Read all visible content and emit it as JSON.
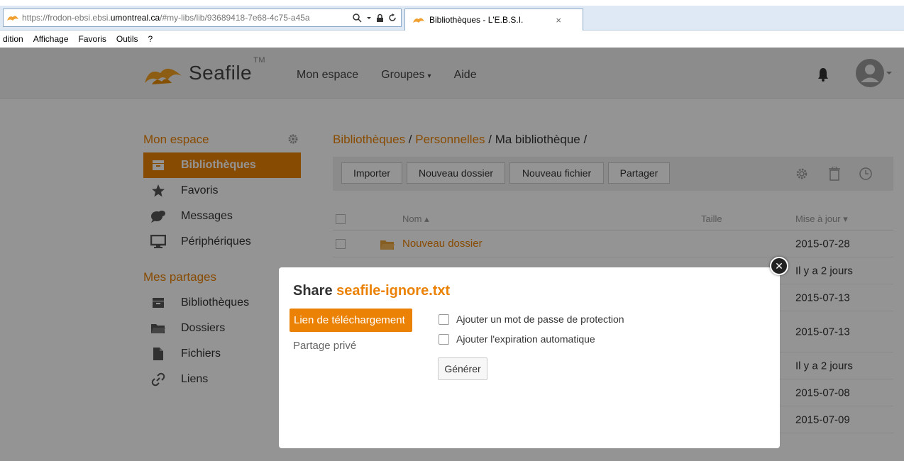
{
  "browser": {
    "url_prefix": "https://",
    "url_host_a": "frodon-ebsi.ebsi.",
    "url_host_b": "umontreal.ca",
    "url_path": "/#my-libs/lib/93689418-7e68-4c75-a45a",
    "tab_title": "Bibliothèques - L'E.B.S.I.",
    "tab_close": "×",
    "menu": [
      "dition",
      "Affichage",
      "Favoris",
      "Outils",
      "?"
    ]
  },
  "header": {
    "logo_sea": "Sea",
    "logo_file": "file",
    "logo_tm": "TM",
    "nav": [
      {
        "label": "Mon espace"
      },
      {
        "label": "Groupes",
        "caret": "▾"
      },
      {
        "label": "Aide"
      }
    ]
  },
  "sidebar": {
    "my_space_title": "Mon espace",
    "items": [
      {
        "label": "Bibliothèques",
        "icon": "library-icon",
        "active": true
      },
      {
        "label": "Favoris",
        "icon": "star-icon"
      },
      {
        "label": "Messages",
        "icon": "message-icon"
      },
      {
        "label": "Périphériques",
        "icon": "monitor-icon"
      }
    ],
    "shares_title": "Mes partages",
    "share_items": [
      {
        "label": "Bibliothèques",
        "icon": "library-icon"
      },
      {
        "label": "Dossiers",
        "icon": "folder-icon"
      },
      {
        "label": "Fichiers",
        "icon": "file-icon"
      },
      {
        "label": "Liens",
        "icon": "link-icon"
      }
    ]
  },
  "main": {
    "breadcrumb": {
      "part1": "Bibliothèques",
      "sep1": " / ",
      "part2": "Personnelles",
      "sep2": " / ",
      "current": "Ma bibliothèque /"
    },
    "toolbar": {
      "import": "Importer",
      "new_folder": "Nouveau dossier",
      "new_file": "Nouveau fichier",
      "share": "Partager"
    },
    "table": {
      "col_name": "Nom",
      "col_name_sort": "▴",
      "col_size": "Taille",
      "col_updated": "Mise à jour",
      "col_updated_sort": "▾",
      "rows": [
        {
          "name": "Nouveau dossier",
          "date": "2015-07-28"
        },
        {
          "name": "",
          "date": "Il y a 2 jours"
        },
        {
          "name": "",
          "date": "2015-07-13"
        },
        {
          "name": "",
          "date": "2015-07-13"
        },
        {
          "name": "",
          "date": "Il y a 2 jours"
        },
        {
          "name": "",
          "date": "2015-07-08"
        },
        {
          "name": "",
          "date": "2015-07-09"
        }
      ]
    }
  },
  "dialog": {
    "title_prefix": "Share ",
    "title_file": "seafile-ignore.txt",
    "tab_download": "Lien de téléchargement",
    "tab_private": "Partage privé",
    "opt_password": "Ajouter un mot de passe de protection",
    "opt_expiry": "Ajouter l'expiration automatique",
    "generate": "Générer",
    "close": "✕"
  },
  "colors": {
    "accent": "#eb8205"
  }
}
